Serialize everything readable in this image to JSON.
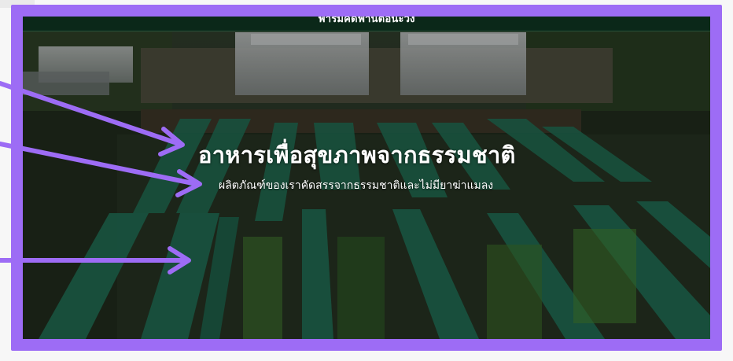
{
  "header": {
    "site_title": "ฟาร์มคิดฟานต่อนะวัง"
  },
  "hero": {
    "headline": "อาหารเพื่อสุขภาพจากธรรมชาติ",
    "subheadline": "ผลิตภัณฑ์ของเราคัดสรรจากธรรมชาติและไม่มียาฆ่าแมลง",
    "image_subject": "aerial-farm-greenhouses-and-shade-net-beds"
  },
  "annotations": {
    "frame_color": "#9d6cf5",
    "arrow_color": "#9d6cf5",
    "arrows": [
      {
        "id": "arrow-to-headline",
        "target": "headline"
      },
      {
        "id": "arrow-to-subheadline",
        "target": "subheadline"
      },
      {
        "id": "arrow-to-image",
        "target": "background-image"
      }
    ]
  },
  "colors": {
    "topbar": "#0a2819",
    "net_green": "#1f6b52",
    "text": "#ffffff"
  }
}
